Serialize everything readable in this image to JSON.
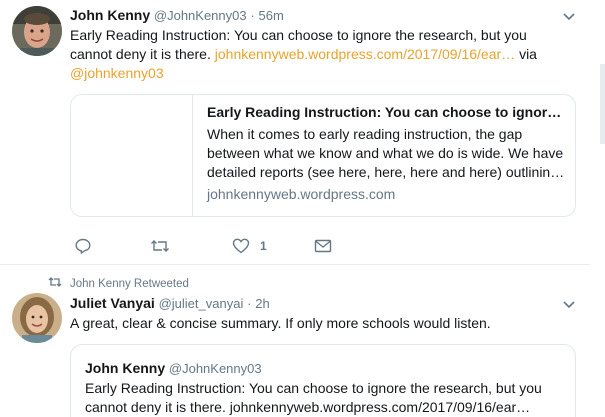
{
  "tweet1": {
    "name": "John Kenny",
    "handle": "@JohnKenny03",
    "separator": "·",
    "time": "56m",
    "text_before": "Early Reading Instruction: You can choose to ignore the research, but you cannot deny it is there.",
    "link": "johnkennyweb.wordpress.com/2017/09/16/ear…",
    "via": "via",
    "mention": "@johnkenny03",
    "card": {
      "title": "Early Reading Instruction: You can choose to ignor…",
      "description": "When it comes to early reading instruction, the gap between what we know and what we do is wide. We have detailed reports (see here, here, here and here) outlinin…",
      "domain": "johnkennyweb.wordpress.com"
    },
    "actions": {
      "reply_icon": "reply-icon",
      "retweet_icon": "retweet-icon",
      "like_icon": "heart-icon",
      "like_count": "1",
      "dm_icon": "envelope-icon"
    }
  },
  "tweet2": {
    "retweeted_by": "John Kenny Retweeted",
    "name": "Juliet Vanyai",
    "handle": "@juliet_vanyai",
    "separator": "·",
    "time": "2h",
    "text": "A great, clear & concise summary. If only more schools would listen.",
    "quote": {
      "name": "John Kenny",
      "handle": "@JohnKenny03",
      "text": "Early Reading Instruction: You can choose to ignore the research, but you cannot deny it is there. johnkennyweb.wordpress.com/2017/09/16/ear…"
    }
  },
  "colors": {
    "link": "#e8a32c",
    "muted": "#657786",
    "border": "#e1e8ed"
  }
}
